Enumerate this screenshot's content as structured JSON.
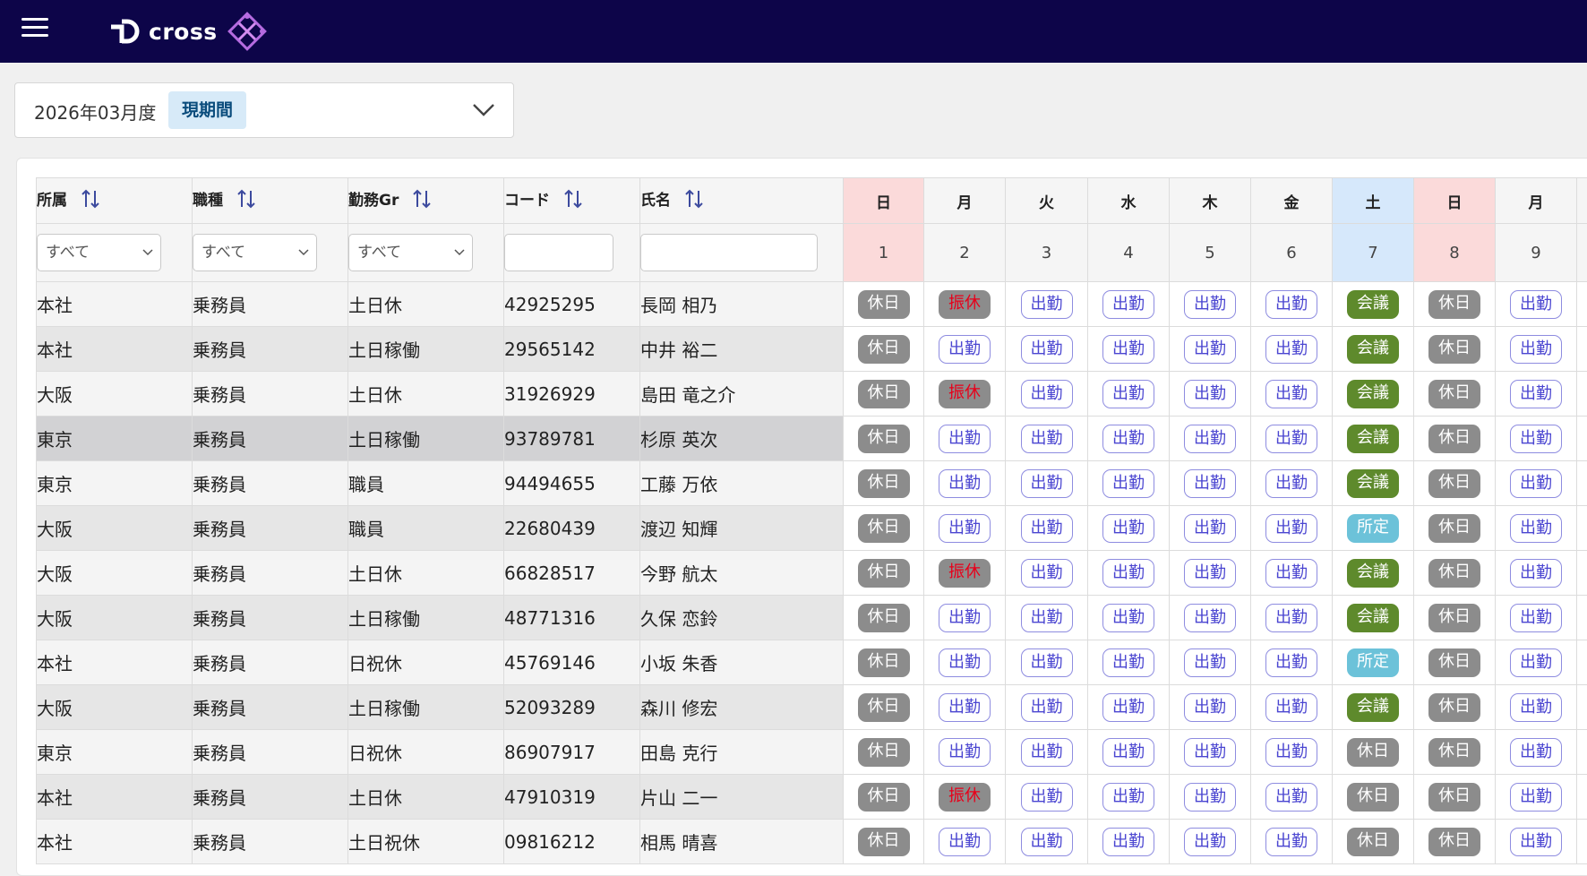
{
  "header": {
    "logo_text": "cross",
    "menu_icon": "hamburger-icon"
  },
  "period": {
    "label": "2026年03月度",
    "badge": "現期間"
  },
  "columns": [
    "所属",
    "職種",
    "勤務Gr",
    "コード",
    "氏名"
  ],
  "filters": {
    "dept": "すべて",
    "job": "すべて",
    "group": "すべて",
    "code": "",
    "name": ""
  },
  "days": [
    {
      "weekday": "日",
      "num": "1"
    },
    {
      "weekday": "月",
      "num": "2"
    },
    {
      "weekday": "火",
      "num": "3"
    },
    {
      "weekday": "水",
      "num": "4"
    },
    {
      "weekday": "木",
      "num": "5"
    },
    {
      "weekday": "金",
      "num": "6"
    },
    {
      "weekday": "土",
      "num": "7"
    },
    {
      "weekday": "日",
      "num": "8"
    },
    {
      "weekday": "月",
      "num": "9"
    }
  ],
  "rows": [
    {
      "dept": "本社",
      "job": "乗務員",
      "group": "土日休",
      "code": "42925295",
      "name": "長岡 相乃",
      "shifts": [
        "休日",
        "振休",
        "出勤",
        "出勤",
        "出勤",
        "出勤",
        "会議",
        "休日",
        "出勤"
      ]
    },
    {
      "dept": "本社",
      "job": "乗務員",
      "group": "土日稼働",
      "code": "29565142",
      "name": "中井 裕二",
      "shifts": [
        "休日",
        "出勤",
        "出勤",
        "出勤",
        "出勤",
        "出勤",
        "会議",
        "休日",
        "出勤"
      ]
    },
    {
      "dept": "大阪",
      "job": "乗務員",
      "group": "土日休",
      "code": "31926929",
      "name": "島田 竜之介",
      "shifts": [
        "休日",
        "振休",
        "出勤",
        "出勤",
        "出勤",
        "出勤",
        "会議",
        "休日",
        "出勤"
      ]
    },
    {
      "dept": "東京",
      "job": "乗務員",
      "group": "土日稼働",
      "code": "93789781",
      "name": "杉原 英次",
      "shifts": [
        "休日",
        "出勤",
        "出勤",
        "出勤",
        "出勤",
        "出勤",
        "会議",
        "休日",
        "出勤"
      ]
    },
    {
      "dept": "東京",
      "job": "乗務員",
      "group": "職員",
      "code": "94494655",
      "name": "工藤 万依",
      "shifts": [
        "休日",
        "出勤",
        "出勤",
        "出勤",
        "出勤",
        "出勤",
        "会議",
        "休日",
        "出勤"
      ]
    },
    {
      "dept": "大阪",
      "job": "乗務員",
      "group": "職員",
      "code": "22680439",
      "name": "渡辺 知輝",
      "shifts": [
        "休日",
        "出勤",
        "出勤",
        "出勤",
        "出勤",
        "出勤",
        "所定",
        "休日",
        "出勤"
      ]
    },
    {
      "dept": "大阪",
      "job": "乗務員",
      "group": "土日休",
      "code": "66828517",
      "name": "今野 航太",
      "shifts": [
        "休日",
        "振休",
        "出勤",
        "出勤",
        "出勤",
        "出勤",
        "会議",
        "休日",
        "出勤"
      ]
    },
    {
      "dept": "大阪",
      "job": "乗務員",
      "group": "土日稼働",
      "code": "48771316",
      "name": "久保 恋鈴",
      "shifts": [
        "休日",
        "出勤",
        "出勤",
        "出勤",
        "出勤",
        "出勤",
        "会議",
        "休日",
        "出勤"
      ]
    },
    {
      "dept": "本社",
      "job": "乗務員",
      "group": "日祝休",
      "code": "45769146",
      "name": "小坂 朱香",
      "shifts": [
        "休日",
        "出勤",
        "出勤",
        "出勤",
        "出勤",
        "出勤",
        "所定",
        "休日",
        "出勤"
      ]
    },
    {
      "dept": "大阪",
      "job": "乗務員",
      "group": "土日稼働",
      "code": "52093289",
      "name": "森川 修宏",
      "shifts": [
        "休日",
        "出勤",
        "出勤",
        "出勤",
        "出勤",
        "出勤",
        "会議",
        "休日",
        "出勤"
      ]
    },
    {
      "dept": "東京",
      "job": "乗務員",
      "group": "日祝休",
      "code": "86907917",
      "name": "田島 克行",
      "shifts": [
        "休日",
        "出勤",
        "出勤",
        "出勤",
        "出勤",
        "出勤",
        "休日",
        "休日",
        "出勤"
      ]
    },
    {
      "dept": "本社",
      "job": "乗務員",
      "group": "土日休",
      "code": "47910319",
      "name": "片山 二一",
      "shifts": [
        "休日",
        "振休",
        "出勤",
        "出勤",
        "出勤",
        "出勤",
        "休日",
        "休日",
        "出勤"
      ]
    },
    {
      "dept": "本社",
      "job": "乗務員",
      "group": "土日祝休",
      "code": "09816212",
      "name": "相馬 晴喜",
      "shifts": [
        "休日",
        "出勤",
        "出勤",
        "出勤",
        "出勤",
        "出勤",
        "休日",
        "休日",
        "出勤"
      ]
    }
  ]
}
